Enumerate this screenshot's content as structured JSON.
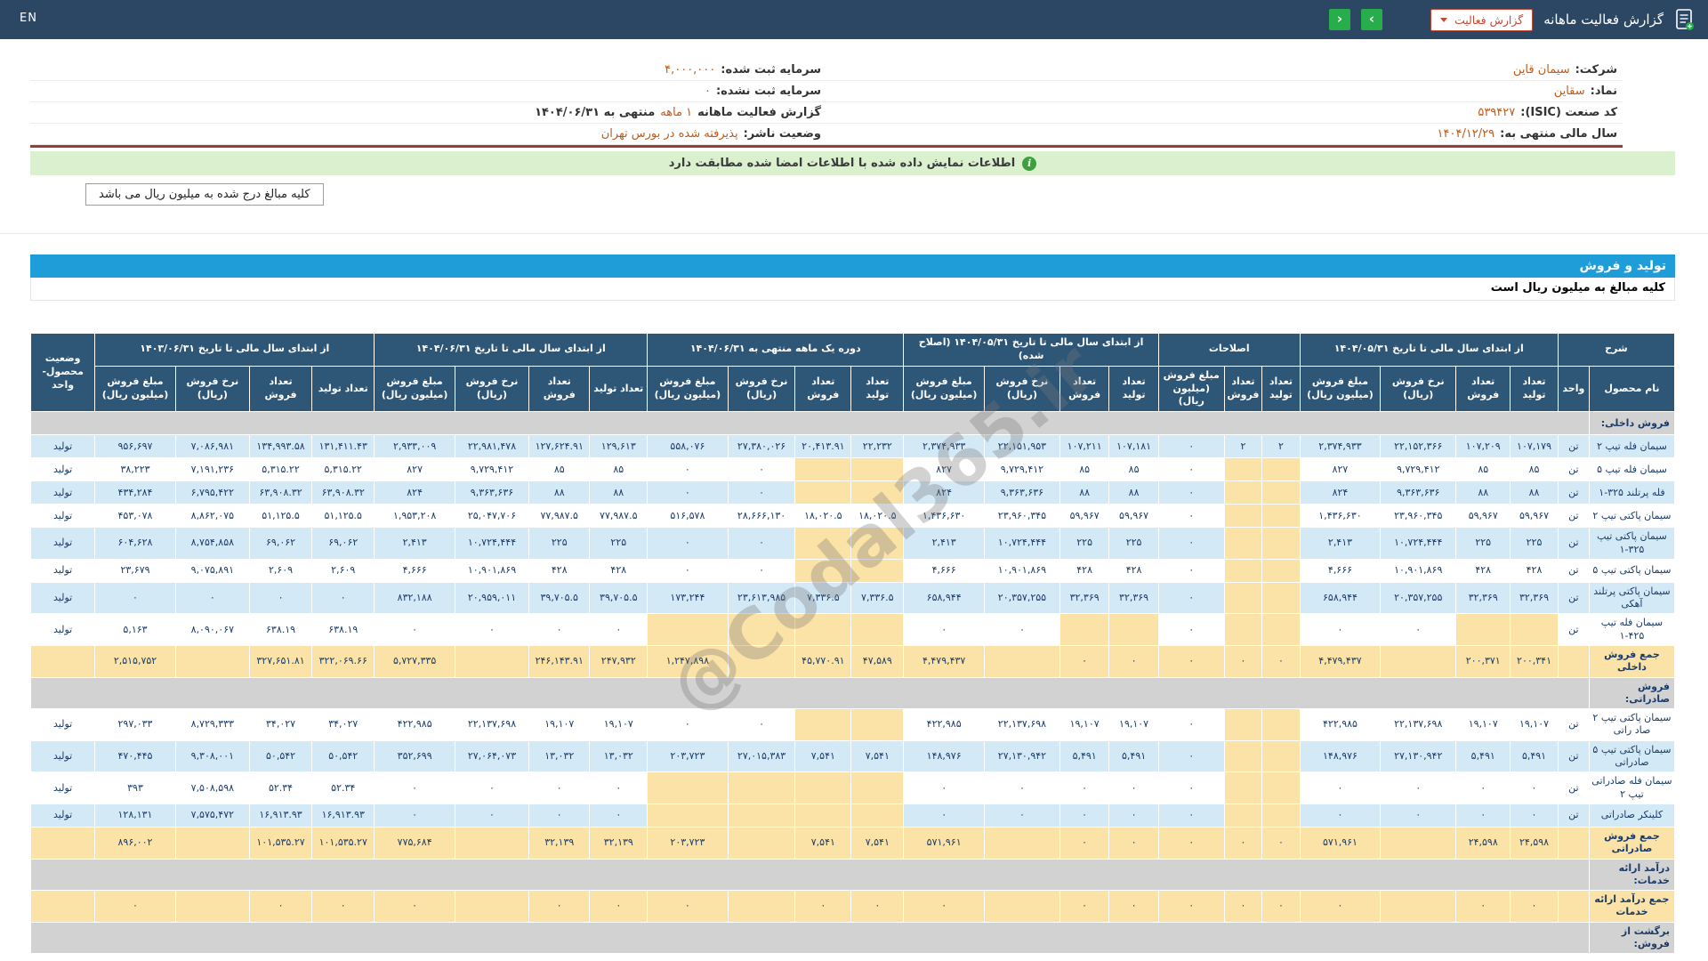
{
  "topbar": {
    "title": "گزارش فعالیت ماهانه",
    "report_button": "گزارش فعالیت",
    "nav_right": "›",
    "nav_left": "‹",
    "en": "EN"
  },
  "info": {
    "right": [
      {
        "label": "شرکت:",
        "value": "سیمان قاین",
        "label2": ""
      },
      {
        "label": "نماد:",
        "value": "سقاین",
        "label2": ""
      },
      {
        "label": "کد صنعت (ISIC):",
        "value": "۵۳۹۴۲۷",
        "label2": ""
      },
      {
        "label": "سال مالی منتهی به:",
        "value": "۱۴۰۴/۱۲/۲۹",
        "label2": ""
      }
    ],
    "left": [
      {
        "label": "سرمایه ثبت شده:",
        "value": "۴,۰۰۰,۰۰۰",
        "label2": ""
      },
      {
        "label": "سرمایه ثبت نشده:",
        "value": "۰",
        "label2": ""
      },
      {
        "label": "گزارش فعالیت ماهانه",
        "value": "۱ ماهه",
        "label2": "منتهی به ۱۴۰۴/۰۶/۳۱"
      },
      {
        "label": "وضعیت ناشر:",
        "value": "پذیرفته شده در بورس تهران",
        "label2": ""
      }
    ]
  },
  "banner": {
    "text": "اطلاعات نمایش داده شده با اطلاعات امضا شده مطابقت دارد"
  },
  "note_box": "کلیه مبالغ درج شده به میلیون ریال می باشد",
  "production": {
    "title": "تولید و فروش",
    "subtitle": "کلیه مبالغ به میلیون ریال است"
  },
  "watermark": "@Codal365.ir",
  "table": {
    "head": {
      "top": [
        {
          "label": "شرح",
          "colspan": 2
        },
        {
          "label": "از ابتدای سال مالی تا تاریخ ۱۴۰۴/۰۵/۳۱",
          "colspan": 4
        },
        {
          "label": "اصلاحات",
          "colspan": 3
        },
        {
          "label": "از ابتدای سال مالی تا تاریخ ۱۴۰۴/۰۵/۳۱ (اصلاح شده)",
          "colspan": 4
        },
        {
          "label": "دوره یک ماهه منتهی به ۱۴۰۴/۰۶/۳۱",
          "colspan": 4
        },
        {
          "label": "از ابتدای سال مالی تا تاریخ ۱۴۰۴/۰۶/۳۱",
          "colspan": 4
        },
        {
          "label": "از ابتدای سال مالی تا تاریخ ۱۴۰۳/۰۶/۳۱",
          "colspan": 4
        },
        {
          "label": "وضعیت محصول-واحد",
          "rowspan": 2
        }
      ],
      "sub": [
        "نام محصول",
        "واحد",
        "تعداد تولید",
        "تعداد فروش",
        "نرخ فروش (ریال)",
        "مبلغ فروش (میلیون ریال)",
        "تعداد تولید",
        "تعداد فروش",
        "مبلغ فروش (میلیون ریال)",
        "تعداد تولید",
        "تعداد فروش",
        "نرخ فروش (ریال)",
        "مبلغ فروش (میلیون ریال)",
        "تعداد تولید",
        "تعداد فروش",
        "نرخ فروش (ریال)",
        "مبلغ فروش (میلیون ریال)",
        "تعداد تولید",
        "تعداد فروش",
        "نرخ فروش (ریال)",
        "مبلغ فروش (میلیون ریال)",
        "تعداد تولید",
        "تعداد فروش",
        "نرخ فروش (ریال)",
        "مبلغ فروش (میلیون ریال)"
      ]
    },
    "rows": [
      {
        "type": "section",
        "label": "فروش داخلی:"
      },
      {
        "type": "data",
        "tone": "blue",
        "cells": [
          "سیمان فله تیپ ۲",
          "تن",
          "۱۰۷,۱۷۹",
          "۱۰۷,۲۰۹",
          "۲۲,۱۵۲,۳۶۶",
          "۲,۳۷۴,۹۳۳",
          "۲",
          "۲",
          "۰",
          "۱۰۷,۱۸۱",
          "۱۰۷,۲۱۱",
          "۲۲,۱۵۱,۹۵۳",
          "۲,۳۷۴,۹۳۳",
          "۲۲,۲۳۲",
          "۲۰,۴۱۳.۹۱",
          "۲۷,۳۸۰,۰۲۶",
          "۵۵۸,۰۷۶",
          "۱۲۹,۶۱۳",
          "۱۲۷,۶۲۴.۹۱",
          "۲۲,۹۸۱,۴۷۸",
          "۲,۹۳۳,۰۰۹",
          "۱۳۱,۴۱۱.۴۳",
          "۱۳۴,۹۹۳.۵۸",
          "۷,۰۸۶,۹۸۱",
          "۹۵۶,۶۹۷",
          "تولید"
        ]
      },
      {
        "type": "data",
        "tone": "white",
        "cells": [
          "سیمان فله تیپ ۵",
          "تن",
          "۸۵",
          "۸۵",
          "۹,۷۲۹,۴۱۲",
          "۸۲۷",
          "",
          "",
          "۰",
          "۸۵",
          "۸۵",
          "۹,۷۲۹,۴۱۲",
          "۸۲۷",
          "",
          "",
          "۰",
          "۰",
          "۸۵",
          "۸۵",
          "۹,۷۲۹,۴۱۲",
          "۸۲۷",
          "۵,۳۱۵.۲۲",
          "۵,۳۱۵.۲۲",
          "۷,۱۹۱,۲۳۶",
          "۳۸,۲۲۳",
          "تولید"
        ]
      },
      {
        "type": "data",
        "tone": "blue",
        "cells": [
          "فله پرتلند ۳۲۵-۱",
          "تن",
          "۸۸",
          "۸۸",
          "۹,۳۶۳,۶۳۶",
          "۸۲۴",
          "",
          "",
          "۰",
          "۸۸",
          "۸۸",
          "۹,۳۶۳,۶۳۶",
          "۸۲۴",
          "",
          "",
          "۰",
          "۰",
          "۸۸",
          "۸۸",
          "۹,۳۶۳,۶۳۶",
          "۸۲۴",
          "۶۳,۹۰۸.۳۲",
          "۶۳,۹۰۸.۳۲",
          "۶,۷۹۵,۴۲۲",
          "۴۳۴,۲۸۴",
          "تولید"
        ]
      },
      {
        "type": "data",
        "tone": "white",
        "cells": [
          "سیمان پاکتی تیپ ۲",
          "تن",
          "۵۹,۹۶۷",
          "۵۹,۹۶۷",
          "۲۳,۹۶۰,۳۴۵",
          "۱,۴۳۶,۶۳۰",
          "",
          "",
          "۰",
          "۵۹,۹۶۷",
          "۵۹,۹۶۷",
          "۲۳,۹۶۰,۳۴۵",
          "۱,۴۳۶,۶۳۰",
          "۱۸,۰۲۰.۵",
          "۱۸,۰۲۰.۵",
          "۲۸,۶۶۶,۱۳۰",
          "۵۱۶,۵۷۸",
          "۷۷,۹۸۷.۵",
          "۷۷,۹۸۷.۵",
          "۲۵,۰۴۷,۷۰۶",
          "۱,۹۵۳,۲۰۸",
          "۵۱,۱۲۵.۵",
          "۵۱,۱۲۵.۵",
          "۸,۸۶۲,۰۷۵",
          "۴۵۳,۰۷۸",
          "تولید"
        ]
      },
      {
        "type": "data",
        "tone": "blue",
        "cells": [
          "سیمان پاکتی تیپ ۳۲۵-۱",
          "تن",
          "۲۲۵",
          "۲۲۵",
          "۱۰,۷۲۴,۴۴۴",
          "۲,۴۱۳",
          "",
          "",
          "۰",
          "۲۲۵",
          "۲۲۵",
          "۱۰,۷۲۴,۴۴۴",
          "۲,۴۱۳",
          "",
          "",
          "۰",
          "۰",
          "۲۲۵",
          "۲۲۵",
          "۱۰,۷۲۴,۴۴۴",
          "۲,۴۱۳",
          "۶۹,۰۶۲",
          "۶۹,۰۶۲",
          "۸,۷۵۴,۸۵۸",
          "۶۰۴,۶۲۸",
          "تولید"
        ]
      },
      {
        "type": "data",
        "tone": "white",
        "cells": [
          "سیمان پاکتی تیپ ۵",
          "تن",
          "۴۲۸",
          "۴۲۸",
          "۱۰,۹۰۱,۸۶۹",
          "۴,۶۶۶",
          "",
          "",
          "۰",
          "۴۲۸",
          "۴۲۸",
          "۱۰,۹۰۱,۸۶۹",
          "۴,۶۶۶",
          "",
          "",
          "۰",
          "۰",
          "۴۲۸",
          "۴۲۸",
          "۱۰,۹۰۱,۸۶۹",
          "۴,۶۶۶",
          "۲,۶۰۹",
          "۲,۶۰۹",
          "۹,۰۷۵,۸۹۱",
          "۲۳,۶۷۹",
          "تولید"
        ]
      },
      {
        "type": "data",
        "tone": "blue",
        "cells": [
          "سیمان پاکتی پرتلند آهکی",
          "تن",
          "۳۲,۳۶۹",
          "۳۲,۳۶۹",
          "۲۰,۳۵۷,۲۵۵",
          "۶۵۸,۹۴۴",
          "",
          "",
          "۰",
          "۳۲,۳۶۹",
          "۳۲,۳۶۹",
          "۲۰,۳۵۷,۲۵۵",
          "۶۵۸,۹۴۴",
          "۷,۳۳۶.۵",
          "۷,۳۳۶.۵",
          "۲۳,۶۱۳,۹۸۵",
          "۱۷۳,۲۴۴",
          "۳۹,۷۰۵.۵",
          "۳۹,۷۰۵.۵",
          "۲۰,۹۵۹,۰۱۱",
          "۸۳۲,۱۸۸",
          "۰",
          "۰",
          "۰",
          "۰",
          "تولید"
        ]
      },
      {
        "type": "data",
        "tone": "white",
        "cells": [
          "سیمان فله تیپ ۴۲۵-۱",
          "تن",
          "",
          "",
          "۰",
          "۰",
          "",
          "",
          "۰",
          "",
          "",
          "۰",
          "۰",
          "",
          "",
          "",
          "",
          "۰",
          "۰",
          "۰",
          "۰",
          "۶۳۸.۱۹",
          "۶۳۸.۱۹",
          "۸,۰۹۰,۰۶۷",
          "۵,۱۶۳",
          "تولید"
        ]
      },
      {
        "type": "data",
        "tone": "sum",
        "cells": [
          "جمع فروش داخلی",
          "",
          "۲۰۰,۳۴۱",
          "۲۰۰,۳۷۱",
          "",
          "۴,۴۷۹,۴۳۷",
          "۰",
          "۰",
          "۰",
          "۰",
          "۰",
          "",
          "۴,۴۷۹,۴۳۷",
          "۴۷,۵۸۹",
          "۴۵,۷۷۰.۹۱",
          "",
          "۱,۲۴۷,۸۹۸",
          "۲۴۷,۹۳۲",
          "۲۴۶,۱۴۳.۹۱",
          "",
          "۵,۷۲۷,۳۳۵",
          "۳۲۲,۰۶۹.۶۶",
          "۳۲۷,۶۵۱.۸۱",
          "",
          "۲,۵۱۵,۷۵۲",
          ""
        ]
      },
      {
        "type": "section",
        "label": "فروش صادراتی:"
      },
      {
        "type": "data",
        "tone": "white",
        "cells": [
          "سیمان پاکتی تیپ ۲ صاد راتی",
          "تن",
          "۱۹,۱۰۷",
          "۱۹,۱۰۷",
          "۲۲,۱۳۷,۶۹۸",
          "۴۲۲,۹۸۵",
          "",
          "",
          "۰",
          "۱۹,۱۰۷",
          "۱۹,۱۰۷",
          "۲۲,۱۳۷,۶۹۸",
          "۴۲۲,۹۸۵",
          "",
          "",
          "۰",
          "۰",
          "۱۹,۱۰۷",
          "۱۹,۱۰۷",
          "۲۲,۱۳۷,۶۹۸",
          "۴۲۲,۹۸۵",
          "۳۴,۰۲۷",
          "۳۴,۰۲۷",
          "۸,۷۲۹,۳۳۳",
          "۲۹۷,۰۳۳",
          "تولید"
        ]
      },
      {
        "type": "data",
        "tone": "blue",
        "cells": [
          "سیمان پاکتی تیپ ۵ صادراتی",
          "تن",
          "۵,۴۹۱",
          "۵,۴۹۱",
          "۲۷,۱۳۰,۹۴۲",
          "۱۴۸,۹۷۶",
          "",
          "",
          "۰",
          "۵,۴۹۱",
          "۵,۴۹۱",
          "۲۷,۱۳۰,۹۴۲",
          "۱۴۸,۹۷۶",
          "۷,۵۴۱",
          "۷,۵۴۱",
          "۲۷,۰۱۵,۳۸۳",
          "۲۰۳,۷۲۳",
          "۱۳,۰۳۲",
          "۱۳,۰۳۲",
          "۲۷,۰۶۴,۰۷۳",
          "۳۵۲,۶۹۹",
          "۵۰,۵۴۲",
          "۵۰,۵۴۲",
          "۹,۳۰۸,۰۰۱",
          "۴۷۰,۴۴۵",
          "تولید"
        ]
      },
      {
        "type": "data",
        "tone": "white",
        "cells": [
          "سیمان فله صادراتی تیپ ۲",
          "تن",
          "۰",
          "۰",
          "۰",
          "۰",
          "",
          "",
          "۰",
          "۰",
          "۰",
          "۰",
          "۰",
          "",
          "",
          "",
          "",
          "۰",
          "۰",
          "۰",
          "۰",
          "۵۲.۳۴",
          "۵۲.۳۴",
          "۷,۵۰۸,۵۹۸",
          "۳۹۳",
          "تولید"
        ]
      },
      {
        "type": "data",
        "tone": "blue",
        "cells": [
          "کلینکر صادراتی",
          "تن",
          "۰",
          "۰",
          "۰",
          "۰",
          "",
          "",
          "۰",
          "۰",
          "۰",
          "۰",
          "۰",
          "",
          "",
          "",
          "",
          "۰",
          "۰",
          "۰",
          "۰",
          "۱۶,۹۱۳.۹۳",
          "۱۶,۹۱۳.۹۳",
          "۷,۵۷۵,۴۷۲",
          "۱۲۸,۱۳۱",
          "تولید"
        ]
      },
      {
        "type": "data",
        "tone": "sum",
        "cells": [
          "جمع فروش صادراتی",
          "",
          "۲۴,۵۹۸",
          "۲۴,۵۹۸",
          "",
          "۵۷۱,۹۶۱",
          "۰",
          "۰",
          "۰",
          "۰",
          "۰",
          "",
          "۵۷۱,۹۶۱",
          "۷,۵۴۱",
          "۷,۵۴۱",
          "",
          "۲۰۳,۷۲۳",
          "۳۲,۱۳۹",
          "۳۲,۱۳۹",
          "",
          "۷۷۵,۶۸۴",
          "۱۰۱,۵۳۵.۲۷",
          "۱۰۱,۵۳۵.۲۷",
          "",
          "۸۹۶,۰۰۲",
          ""
        ]
      },
      {
        "type": "section",
        "label": "درآمد ارائه خدمات:"
      },
      {
        "type": "data",
        "tone": "sum",
        "cells": [
          "جمع درآمد ارائه خدمات",
          "",
          "۰",
          "۰",
          "",
          "۰",
          "۰",
          "۰",
          "۰",
          "۰",
          "۰",
          "",
          "۰",
          "۰",
          "۰",
          "",
          "۰",
          "۰",
          "۰",
          "",
          "۰",
          "۰",
          "۰",
          "",
          "۰",
          ""
        ]
      },
      {
        "type": "section",
        "label": "برگشت از فروش:"
      }
    ]
  }
}
